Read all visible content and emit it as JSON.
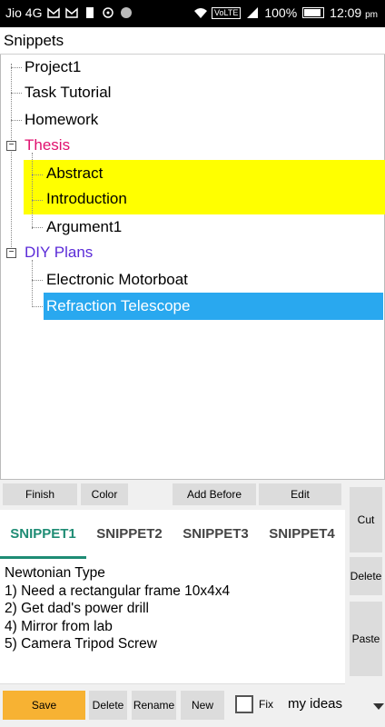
{
  "status": {
    "carrier": "Jio 4G",
    "volte": "VoLTE",
    "battery": "100%",
    "time": "12:09",
    "ampm": "pm"
  },
  "app": {
    "title": "Snippets"
  },
  "tree": {
    "items": [
      {
        "label": "Project1",
        "color": "#000000"
      },
      {
        "label": "Task Tutorial",
        "color": "#000000"
      },
      {
        "label": "Homework",
        "color": "#000000"
      },
      {
        "label": "Thesis",
        "color": "#e0116f"
      },
      {
        "label": "Abstract",
        "color": "#000000"
      },
      {
        "label": "Introduction",
        "color": "#000000"
      },
      {
        "label": "Argument1",
        "color": "#000000"
      },
      {
        "label": "DIY Plans",
        "color": "#5b2bd8"
      },
      {
        "label": "Electronic Motorboat",
        "color": "#000000"
      },
      {
        "label": "Refraction Telescope",
        "color": "#ffffff"
      }
    ],
    "expander_symbol": "−",
    "highlight_yellow": "#ffff00",
    "highlight_blue": "#29a8ef"
  },
  "toolbar": {
    "finish": "Finish",
    "color": "Color",
    "add_before": "Add Before",
    "edit": "Edit",
    "cut": "Cut",
    "delete": "Delete",
    "paste": "Paste"
  },
  "tabs": [
    "SNIPPET1",
    "SNIPPET2",
    "SNIPPET3",
    "SNIPPET4"
  ],
  "accent": "#1e8c74",
  "editor": {
    "lines": [
      "Newtonian Type",
      "1) Need a rectangular frame 10x4x4",
      "2) Get dad's power drill",
      "4) Mirror from lab",
      "5) Camera Tripod Screw"
    ]
  },
  "bottom": {
    "save": "Save",
    "delete": "Delete",
    "rename": "Rename",
    "new": "New",
    "fix": "Fix",
    "category": "my ideas"
  }
}
